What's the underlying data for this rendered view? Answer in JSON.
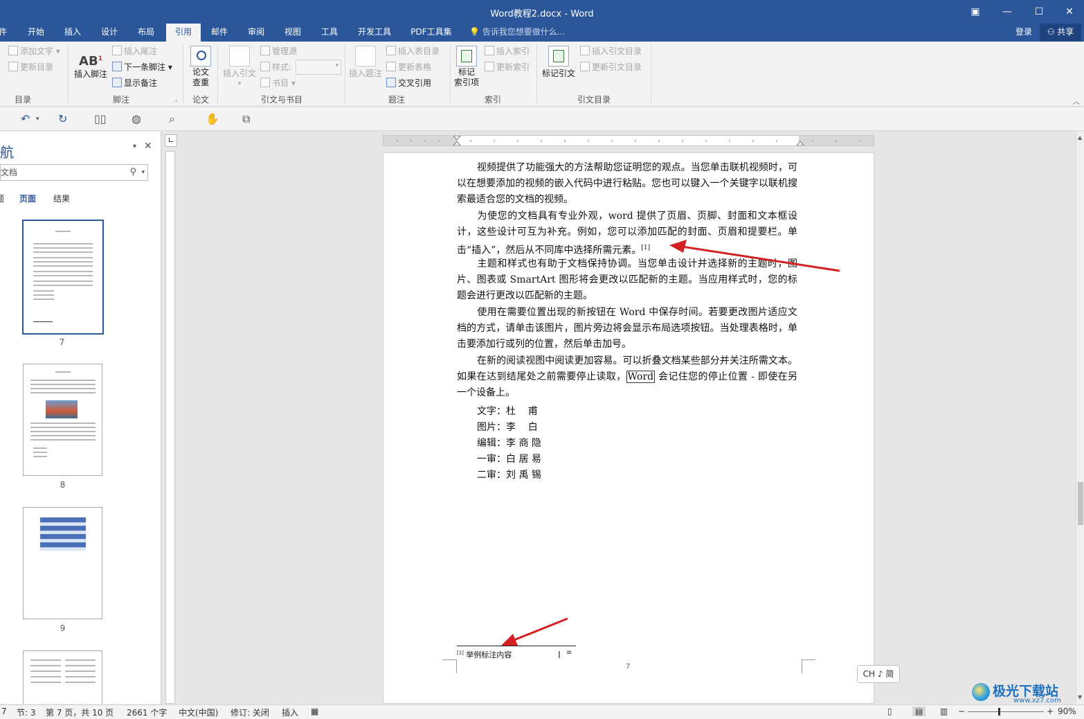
{
  "window": {
    "title": "Word教程2.docx - Word"
  },
  "ribbon_tabs": [
    "件",
    "开始",
    "插入",
    "设计",
    "布局",
    "引用",
    "邮件",
    "审阅",
    "视图",
    "工具",
    "开发工具",
    "PDF工具集"
  ],
  "active_tab": "引用",
  "tell_me": "告诉我您想要做什么...",
  "account": {
    "login": "登录",
    "share": "共享"
  },
  "ribbon": {
    "toc": {
      "add_text": "添加文字",
      "update_toc": "更新目录",
      "label": "目录"
    },
    "footnotes": {
      "insert_footnote": "插入脚注",
      "insert_endnote": "插入尾注",
      "next_footnote": "下一条脚注",
      "show_notes": "显示备注",
      "label": "脚注"
    },
    "paper": {
      "check": "论文\n查重",
      "label": "论文"
    },
    "citations": {
      "insert_citation": "插入引文",
      "manage_sources": "管理源",
      "style": "样式:",
      "bibliography": "书目",
      "label": "引文与书目"
    },
    "captions": {
      "insert_caption": "插入题注",
      "insert_table_of_figures": "插入表目录",
      "update_table": "更新表格",
      "cross_reference": "交叉引用",
      "label": "题注"
    },
    "index": {
      "mark_entry": "标记\n索引项",
      "insert_index": "插入索引",
      "update_index": "更新索引",
      "label": "索引"
    },
    "toa": {
      "mark_citation": "标记引文",
      "insert_toa": "插入引文目录",
      "update_toa": "更新引文目录",
      "label": "引文目录"
    }
  },
  "nav": {
    "title": "航",
    "search_placeholder": "文档",
    "tabs": [
      "题",
      "页面",
      "结果"
    ],
    "active_tab": "页面",
    "pages": [
      "7",
      "8",
      "9"
    ]
  },
  "document": {
    "paragraphs": [
      "视频提供了功能强大的方法帮助您证明您的观点。当您单击联机视频时，可以在想要添加的视频的嵌入代码中进行粘贴。您也可以键入一个关键字以联机搜索最适合您的文档的视频。",
      "为使您的文档具有专业外观，word 提供了页眉、页脚、封面和文本框设计，这些设计可互为补充。例如，您可以添加匹配的封面、页眉和提要栏。单击“插入”，然后从不同库中选择所需元素。",
      "主题和样式也有助于文档保持协调。当您单击设计并选择新的主题时，图片、图表或 SmartArt 图形将会更改以匹配新的主题。当应用样式时，您的标题会进行更改以匹配新的主题。",
      "使用在需要位置出现的新按钮在 Word 中保存时间。若要更改图片适应文档的方式，请单击该图片，图片旁边将会显示布局选项按钮。当处理表格时，单击要添加行或列的位置，然后单击加号。"
    ],
    "para5_a": "在新的阅读视图中阅读更加容易。可以折叠文档某些部分并关注所需文本。如果在达到结尾处之前需要停止读取，",
    "para5_word": "Word",
    "para5_b": " 会记住您的停止位置 - 即使在另一个设备上。",
    "footnote_ref": "[1]",
    "credits": [
      {
        "role": "文字：",
        "name": "杜    甫"
      },
      {
        "role": "图片：",
        "name": "李    白"
      },
      {
        "role": "编辑：",
        "name": "李 商 隐"
      },
      {
        "role": "一审：",
        "name": "白 居 易"
      },
      {
        "role": "二审：",
        "name": "刘 禹 锡"
      }
    ],
    "footnote_mark": "[1]",
    "footnote_text": "举例标注内容",
    "page_number": "7"
  },
  "statusbar": {
    "section_num": "7",
    "section": "节: 3",
    "page": "第 7 页，共 10 页",
    "words": "2661 个字",
    "language": "中文(中国)",
    "track": "修订: 关闭",
    "mode": "插入",
    "zoom": "90%"
  },
  "ime": "CH ♪ 简",
  "watermark": {
    "name": "极光下载站",
    "url": "www.xz7.com"
  },
  "colors": {
    "brand": "#2b579a",
    "arrow": "#d42020"
  }
}
